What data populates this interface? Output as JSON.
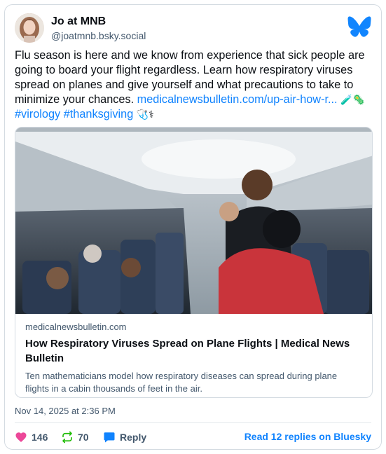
{
  "author": {
    "display_name": "Jo at MNB",
    "handle": "@joatmnb.bsky.social"
  },
  "post": {
    "text_1": "Flu season is here and we know from experience that sick people are going to board your flight regardless. Learn how respiratory viruses spread on planes and give yourself and what precautions to take to minimize your chances. ",
    "link_text": "medicalnewsbulletin.com/up-air-how-r...",
    "emoji_1": "🧪🦠",
    "hashtag_1": "#virology",
    "hashtag_2": "#thanksgiving",
    "emoji_2": "🩺⚕"
  },
  "embed": {
    "domain": "medicalnewsbulletin.com",
    "title": "How Respiratory Viruses Spread on Plane Flights | Medical News Bulletin",
    "description": "Ten mathematicians model how respiratory diseases can spread during plane flights in a cabin thousands of feet in the air."
  },
  "timestamp": "Nov 14, 2025 at 2:36 PM",
  "actions": {
    "likes": "146",
    "reposts": "70",
    "reply_label": "Reply",
    "read_replies": "Read 12 replies on Bluesky"
  },
  "colors": {
    "link": "#1083fe",
    "like": "#ec4899",
    "repost": "#20bc07",
    "reply": "#1083fe",
    "bluesky": "#1185fe"
  },
  "icons": {
    "logo": "bluesky-butterfly-icon",
    "like": "heart-icon",
    "repost": "repost-icon",
    "reply": "speech-bubble-icon"
  }
}
